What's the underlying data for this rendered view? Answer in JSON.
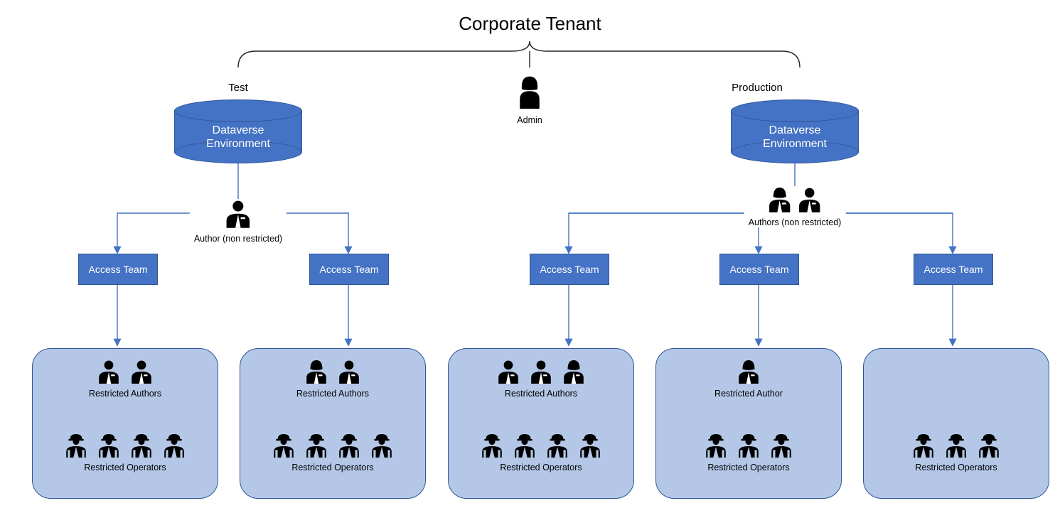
{
  "title": "Corporate Tenant",
  "admin_label": "Admin",
  "environments": {
    "test": {
      "heading": "Test",
      "cylinder": "Dataverse\nEnvironment",
      "author_label": "Author (non restricted)",
      "teams": [
        "Access Team",
        "Access Team"
      ],
      "groups": [
        {
          "authors_label": "Restricted Authors",
          "operators_label": "Restricted Operators",
          "author_count": 2,
          "operator_count": 4,
          "author_gender": [
            "m",
            "m"
          ]
        },
        {
          "authors_label": "Restricted Authors",
          "operators_label": "Restricted Operators",
          "author_count": 2,
          "operator_count": 4,
          "author_gender": [
            "f",
            "m"
          ]
        }
      ]
    },
    "production": {
      "heading": "Production",
      "cylinder": "Dataverse\nEnvironment",
      "authors_label": "Authors (non restricted)",
      "teams": [
        "Access Team",
        "Access Team",
        "Access Team"
      ],
      "groups": [
        {
          "authors_label": "Restricted Authors",
          "operators_label": "Restricted Operators",
          "author_count": 3,
          "operator_count": 4,
          "author_gender": [
            "m",
            "m",
            "f"
          ]
        },
        {
          "authors_label": "Restricted Author",
          "operators_label": "Restricted Operators",
          "author_count": 1,
          "operator_count": 3,
          "author_gender": [
            "f"
          ]
        },
        {
          "authors_label": "",
          "operators_label": "Restricted Operators",
          "author_count": 0,
          "operator_count": 3
        }
      ]
    }
  },
  "colors": {
    "primary": "#4472c4",
    "primary_border": "#2f5597",
    "group_fill": "#b4c7e7"
  }
}
